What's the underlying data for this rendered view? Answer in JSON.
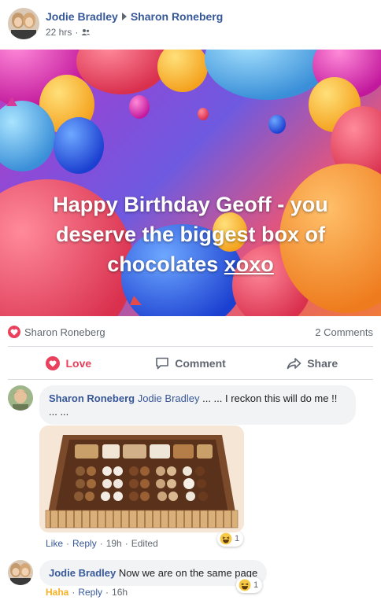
{
  "post": {
    "author": "Jodie Bradley",
    "recipient": "Sharon Roneberg",
    "time": "22 hrs",
    "audience_icon": "friends-icon",
    "image_text": "Happy Birthday Geoff - you deserve the biggest box of chocolates",
    "image_text_link": "xoxo"
  },
  "reactions": {
    "reactor": "Sharon Roneberg",
    "icon": "love-icon",
    "comments_count": "2 Comments"
  },
  "actions": {
    "love": "Love",
    "comment": "Comment",
    "share": "Share"
  },
  "comments": [
    {
      "author": "Sharon Roneberg",
      "tagged": "Jodie Bradley",
      "text": "... ... I reckon this will do me !! ... ...",
      "like": "Like",
      "reply": "Reply",
      "time": "19h",
      "edited": "Edited",
      "reaction_count": "1"
    },
    {
      "author": "Jodie Bradley",
      "text": "Now we are on the same page",
      "reaction": "Haha",
      "reply": "Reply",
      "time": "16h",
      "reaction_count": "1"
    }
  ],
  "colors": {
    "link": "#365899",
    "love": "#e9405b",
    "haha": "#f7b125",
    "muted": "#606770"
  }
}
